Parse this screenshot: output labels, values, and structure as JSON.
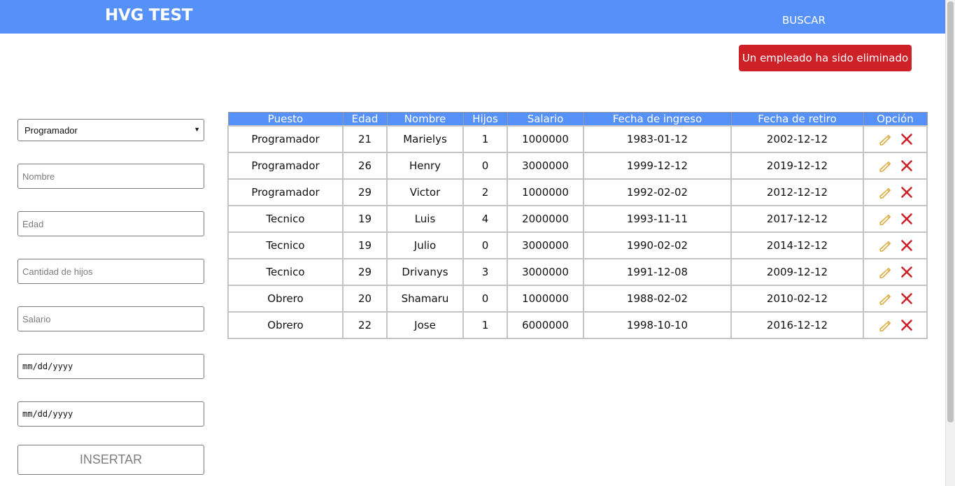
{
  "header": {
    "brand": "HVG TEST",
    "search_link": "BUSCAR"
  },
  "alert": {
    "message": "Un empleado ha sido eliminado",
    "color": "#cd2027"
  },
  "colors": {
    "accent": "#5591f8"
  },
  "form": {
    "puesto_selected": "Programador",
    "nombre_placeholder": "Nombre",
    "edad_placeholder": "Edad",
    "hijos_placeholder": "Cantidad de hijos",
    "salario_placeholder": "Salario",
    "fecha_ingreso_placeholder": "mm/dd/yyyy",
    "fecha_retiro_placeholder": "mm/dd/yyyy",
    "insert_label": "INSERTAR"
  },
  "table": {
    "headers": [
      "Puesto",
      "Edad",
      "Nombre",
      "Hijos",
      "Salario",
      "Fecha de ingreso",
      "Fecha de retiro",
      "Opción"
    ],
    "rows": [
      [
        "Programador",
        "21",
        "Marielys",
        "1",
        "1000000",
        "1983-01-12",
        "2002-12-12"
      ],
      [
        "Programador",
        "26",
        "Henry",
        "0",
        "3000000",
        "1999-12-12",
        "2019-12-12"
      ],
      [
        "Programador",
        "29",
        "Victor",
        "2",
        "1000000",
        "1992-02-02",
        "2012-12-12"
      ],
      [
        "Tecnico",
        "19",
        "Luis",
        "4",
        "2000000",
        "1993-11-11",
        "2017-12-12"
      ],
      [
        "Tecnico",
        "19",
        "Julio",
        "0",
        "3000000",
        "1990-02-02",
        "2014-12-12"
      ],
      [
        "Tecnico",
        "29",
        "Drivanys",
        "3",
        "3000000",
        "1991-12-08",
        "2009-12-12"
      ],
      [
        "Obrero",
        "20",
        "Shamaru",
        "0",
        "1000000",
        "1988-02-02",
        "2010-02-12"
      ],
      [
        "Obrero",
        "22",
        "Jose",
        "1",
        "6000000",
        "1998-10-10",
        "2016-12-12"
      ]
    ],
    "option_icons": [
      "pencil-icon",
      "close-icon"
    ]
  }
}
